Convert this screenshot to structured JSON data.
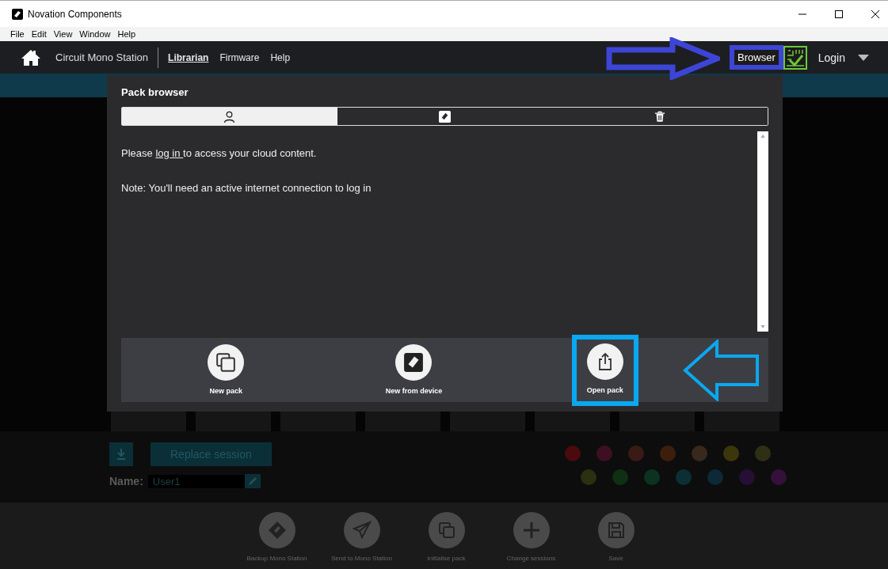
{
  "window": {
    "title": "Novation Components"
  },
  "menu": [
    "File",
    "Edit",
    "View",
    "Window",
    "Help"
  ],
  "nav": {
    "device": "Circuit Mono Station",
    "links": [
      {
        "label": "Librarian",
        "selected": true
      },
      {
        "label": "Firmware",
        "selected": false
      },
      {
        "label": "Help",
        "selected": false
      }
    ],
    "browser": "Browser",
    "browser_highlighted": true,
    "login": "Login"
  },
  "pack_browser": {
    "title": "Pack browser",
    "tabs": [
      {
        "kind": "user",
        "selected": true
      },
      {
        "kind": "device",
        "selected": false
      },
      {
        "kind": "trash",
        "selected": false
      }
    ],
    "message": {
      "before": "Please ",
      "link": "log in ",
      "after": "to access your cloud content."
    },
    "note": "Note: You'll need an active internet connection to log in",
    "actions": [
      {
        "kind": "new",
        "label": "New pack",
        "highlighted": false
      },
      {
        "kind": "device",
        "label": "New from device",
        "highlighted": false
      },
      {
        "kind": "open",
        "label": "Open pack",
        "highlighted": true
      }
    ]
  },
  "annotations": [
    {
      "kind": "right-arrow",
      "color": "#3d45d6"
    },
    {
      "kind": "left-arrow",
      "color": "#0aa8f0"
    }
  ],
  "session": {
    "replace": "Replace session",
    "name_label": "Name:",
    "name_value": "User1",
    "colors": [
      {
        "color": "#4a0a0e"
      },
      {
        "color": "#3e0f22"
      },
      {
        "color": "#3a1a15"
      },
      {
        "color": "#3d1e0c"
      },
      {
        "color": "#38291c"
      },
      {
        "color": "#3c360b"
      },
      {
        "color": "#2f2f14"
      },
      {
        "color": "#2a3010"
      },
      {
        "color": "#0f3012"
      },
      {
        "color": "#0c3320"
      },
      {
        "color": "#0c2f33"
      },
      {
        "color": "#0d2938"
      },
      {
        "color": "#250f35"
      },
      {
        "color": "#35103a"
      }
    ]
  },
  "toolbar": [
    {
      "kind": "backup",
      "label": "Backup Mono Station"
    },
    {
      "kind": "send",
      "label": "Send to Mono Station"
    },
    {
      "kind": "init",
      "label": "Initialise pack"
    },
    {
      "kind": "change",
      "label": "Change sessions"
    },
    {
      "kind": "save",
      "label": "Save"
    }
  ]
}
